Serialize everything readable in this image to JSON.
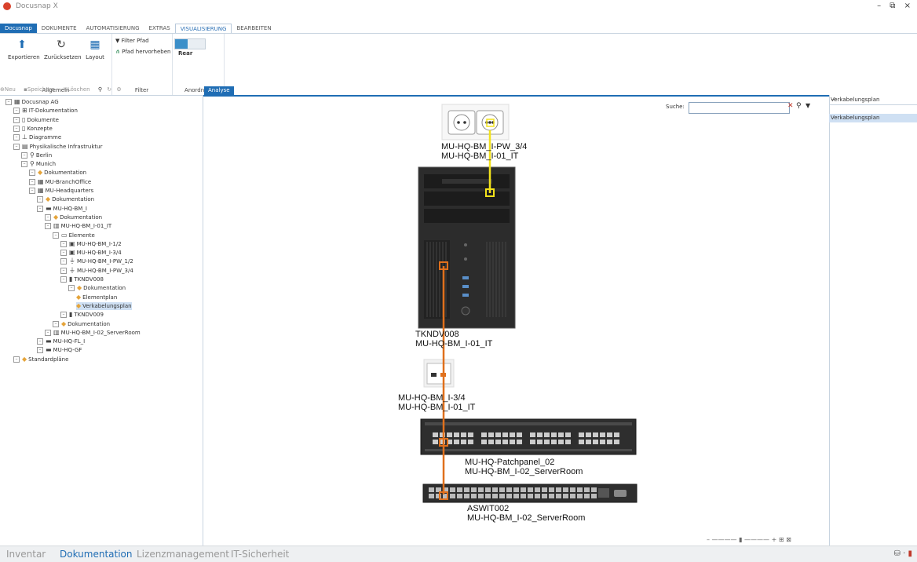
{
  "app": {
    "title": "Docusnap X",
    "window_controls": "– ⧉ ×"
  },
  "ribbon_tabs": [
    {
      "label": "Docusnap"
    },
    {
      "label": "DOKUMENTE"
    },
    {
      "label": "AUTOMATISIERUNG"
    },
    {
      "label": "EXTRAS"
    },
    {
      "label": "VISUALISIERUNG"
    },
    {
      "label": "BEARBEITEN"
    }
  ],
  "ribbon": {
    "groups": {
      "allgemein": "Allgemein",
      "filter": "Filter",
      "anordnen": "Anordnen"
    },
    "buttons": {
      "export": "Exportieren",
      "reset": "Zurücksetzen",
      "layout": "Layout",
      "filter_path": "Filter Pfad",
      "highlight_path": "Pfad hervorheben",
      "rear": "Rear"
    }
  },
  "left_toolbar": {
    "new": "Neu",
    "save": "Speichern",
    "delete": "Löschen"
  },
  "tree": [
    {
      "label": "Docusnap AG",
      "depth": 0,
      "icon": "building"
    },
    {
      "label": "IT-Dokumentation",
      "depth": 1,
      "icon": "network"
    },
    {
      "label": "Dokumente",
      "depth": 1,
      "icon": "doc"
    },
    {
      "label": "Konzepte",
      "depth": 1,
      "icon": "doc"
    },
    {
      "label": "Diagramme",
      "depth": 1,
      "icon": "diagram"
    },
    {
      "label": "Physikalische Infrastruktur",
      "depth": 1,
      "icon": "server"
    },
    {
      "label": "Berlin",
      "depth": 2,
      "icon": "pin"
    },
    {
      "label": "Munich",
      "depth": 2,
      "icon": "pin"
    },
    {
      "label": "Dokumentation",
      "depth": 3,
      "icon": "folder"
    },
    {
      "label": "MU-BranchOffice",
      "depth": 3,
      "icon": "building"
    },
    {
      "label": "MU-Headquarters",
      "depth": 3,
      "icon": "building"
    },
    {
      "label": "Dokumentation",
      "depth": 4,
      "icon": "folder"
    },
    {
      "label": "MU-HQ-BM_I",
      "depth": 4,
      "icon": "floor"
    },
    {
      "label": "Dokumentation",
      "depth": 5,
      "icon": "folder"
    },
    {
      "label": "MU-HQ-BM_I-01_IT",
      "depth": 5,
      "icon": "room"
    },
    {
      "label": "Elemente",
      "depth": 6,
      "icon": "list"
    },
    {
      "label": "MU-HQ-BM_I-1/2",
      "depth": 7,
      "icon": "port"
    },
    {
      "label": "MU-HQ-BM_I-3/4",
      "depth": 7,
      "icon": "port"
    },
    {
      "label": "MU-HQ-BM_I-PW_1/2",
      "depth": 7,
      "icon": "plug"
    },
    {
      "label": "MU-HQ-BM_I-PW_3/4",
      "depth": 7,
      "icon": "plug"
    },
    {
      "label": "TKNDV008",
      "depth": 7,
      "icon": "pc"
    },
    {
      "label": "Dokumentation",
      "depth": 8,
      "icon": "folder"
    },
    {
      "label": "Elementplan",
      "depth": 9,
      "icon": "folder"
    },
    {
      "label": "Verkabelungsplan",
      "depth": 9,
      "icon": "folder",
      "selected": true
    },
    {
      "label": "TKNDV009",
      "depth": 7,
      "icon": "pc"
    },
    {
      "label": "Dokumentation",
      "depth": 6,
      "icon": "folder"
    },
    {
      "label": "MU-HQ-BM_I-02_ServerRoom",
      "depth": 5,
      "icon": "room"
    },
    {
      "label": "MU-HQ-FL_I",
      "depth": 4,
      "icon": "floor"
    },
    {
      "label": "MU-HQ-GF",
      "depth": 4,
      "icon": "floor"
    },
    {
      "label": "Standardpläne",
      "depth": 1,
      "icon": "folder"
    }
  ],
  "doc_tab": "Analyse",
  "search": {
    "label": "Suche:",
    "value": ""
  },
  "diagram": {
    "socket": {
      "line1": "MU-HQ-BM_I-PW_3/4",
      "line2": "MU-HQ-BM_I-01_IT"
    },
    "pc": {
      "line1": "TKNDV008",
      "line2": "MU-HQ-BM_I-01_IT"
    },
    "wallport": {
      "line1": "MU-HQ-BM_I-3/4",
      "line2": "MU-HQ-BM_I-01_IT"
    },
    "patchpanel": {
      "line1": "MU-HQ-Patchpanel_02",
      "line2": "MU-HQ-BM_I-02_ServerRoom"
    },
    "switch": {
      "line1": "ASWIT002",
      "line2": "MU-HQ-BM_I-02_ServerRoom"
    },
    "colors": {
      "power_cable": "#f2e21b",
      "network_cable": "#e0701c"
    }
  },
  "right_panel": {
    "header": "Verkabelungsplan",
    "item": "Verkabelungsplan"
  },
  "statusbar": {
    "tabs": [
      "Inventar",
      "Dokumentation",
      "Lizenzmanagement",
      "IT-Sicherheit"
    ],
    "active": "Dokumentation"
  }
}
